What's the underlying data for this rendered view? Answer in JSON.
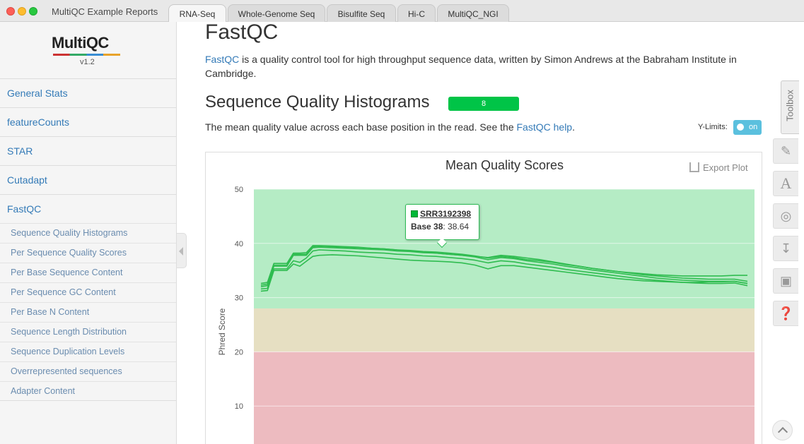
{
  "window": {
    "title": "MultiQC Example Reports",
    "tabs": [
      "RNA-Seq",
      "Whole-Genome Seq",
      "Bisulfite Seq",
      "Hi-C",
      "MultiQC_NGI"
    ],
    "active_tab": "RNA-Seq"
  },
  "sidebar": {
    "logo": "MultiQC",
    "version": "v1.2",
    "main_items": [
      "General Stats",
      "featureCounts",
      "STAR",
      "Cutadapt",
      "FastQC"
    ],
    "sub_items": [
      "Sequence Quality Histograms",
      "Per Sequence Quality Scores",
      "Per Base Sequence Content",
      "Per Sequence GC Content",
      "Per Base N Content",
      "Sequence Length Distribution",
      "Sequence Duplication Levels",
      "Overrepresented sequences",
      "Adapter Content"
    ]
  },
  "main": {
    "title": "FastQC",
    "intro_link": "FastQC",
    "intro_text": " is a quality control tool for high throughput sequence data, written by Simon Andrews at the Babraham Institute in Cambridge.",
    "section_title": "Sequence Quality Histograms",
    "badge_count": "8",
    "section_desc": "The mean quality value across each base position in the read. See the ",
    "section_link": "FastQC help",
    "section_desc_end": ".",
    "ylimits_label": "Y-Limits:",
    "ylimits_state": "on"
  },
  "plot": {
    "export_label": "Export Plot",
    "tooltip": {
      "sample": "SRR3192398",
      "base_label": "Base 38",
      "value": ": 38.64"
    }
  },
  "toolbox": {
    "label": "Toolbox",
    "tools": [
      "pin-icon",
      "font-icon",
      "eye-slash-icon",
      "download-icon",
      "save-icon",
      "question-icon"
    ]
  },
  "colors": {
    "good_zone": "#b5ecc5",
    "warn_zone": "#e6dfc2",
    "fail_zone": "#edbbc0",
    "line": "#2fbc50",
    "link": "#337ab7",
    "badge": "#00c447"
  },
  "chart_data": {
    "type": "line",
    "title": "Mean Quality Scores",
    "xlabel": "",
    "ylabel": "Phred Score",
    "ylim": [
      0,
      50
    ],
    "yticks": [
      10,
      20,
      30,
      40,
      50
    ],
    "zones": [
      {
        "from": 0,
        "to": 20,
        "color": "#edbbc0"
      },
      {
        "from": 20,
        "to": 28,
        "color": "#e6dfc2"
      },
      {
        "from": 28,
        "to": 50,
        "color": "#b5ecc5"
      }
    ],
    "x": [
      1,
      2,
      3,
      4,
      5,
      6,
      7,
      8,
      9,
      10,
      12,
      14,
      16,
      18,
      20,
      22,
      24,
      26,
      28,
      30,
      32,
      34,
      36,
      38,
      40,
      42,
      44,
      46,
      48,
      50,
      52,
      54,
      56,
      58,
      60,
      62,
      64,
      66,
      68,
      70,
      72,
      74,
      76
    ],
    "series": [
      {
        "values": [
          32.0,
          32.2,
          35.8,
          35.8,
          35.8,
          37.8,
          37.8,
          37.8,
          39.2,
          39.3,
          39.2,
          39.1,
          39.0,
          38.9,
          38.8,
          38.6,
          38.5,
          38.3,
          38.2,
          38.0,
          37.8,
          37.5,
          37.0,
          37.4,
          37.2,
          36.8,
          36.5,
          36.2,
          35.8,
          35.5,
          35.1,
          34.8,
          34.5,
          34.2,
          33.9,
          33.6,
          33.4,
          33.2,
          33.1,
          33.0,
          33.0,
          33.0,
          32.6
        ]
      },
      {
        "values": [
          32.3,
          32.5,
          36.0,
          36.0,
          36.0,
          38.0,
          38.0,
          38.0,
          39.4,
          39.5,
          39.4,
          39.3,
          39.2,
          39.1,
          39.0,
          38.8,
          38.7,
          38.5,
          38.4,
          38.2,
          38.0,
          37.7,
          37.3,
          37.6,
          37.4,
          37.0,
          36.8,
          36.5,
          36.1,
          35.8,
          35.4,
          35.1,
          34.8,
          34.5,
          34.2,
          34.0,
          33.8,
          33.6,
          33.5,
          33.4,
          33.4,
          33.4,
          33.0
        ]
      },
      {
        "values": [
          31.6,
          31.7,
          35.3,
          35.3,
          35.3,
          36.8,
          36.5,
          37.3,
          38.6,
          38.8,
          38.7,
          38.6,
          38.4,
          38.3,
          38.2,
          38.0,
          37.9,
          37.7,
          37.6,
          37.4,
          37.2,
          36.9,
          36.4,
          36.8,
          36.6,
          36.2,
          35.9,
          35.6,
          35.2,
          34.9,
          34.6,
          34.3,
          34.0,
          33.7,
          33.4,
          33.2,
          33.0,
          32.8,
          32.7,
          32.6,
          32.6,
          32.7,
          32.2
        ]
      },
      {
        "values": [
          31.2,
          31.3,
          35.0,
          35.0,
          35.0,
          36.2,
          35.8,
          36.7,
          37.6,
          37.8,
          37.9,
          37.8,
          37.7,
          37.5,
          37.3,
          37.1,
          36.9,
          36.8,
          36.7,
          36.6,
          36.4,
          36.0,
          35.3,
          35.9,
          35.9,
          35.6,
          35.3,
          35.0,
          34.7,
          34.4,
          34.1,
          33.8,
          33.5,
          33.3,
          33.1,
          33.0,
          32.9,
          32.8,
          32.8,
          32.9,
          32.9,
          33.0,
          32.6
        ]
      },
      {
        "values": [
          32.6,
          32.8,
          36.3,
          36.3,
          36.3,
          38.2,
          38.2,
          38.3,
          39.6,
          39.6,
          39.5,
          39.4,
          39.3,
          39.1,
          39.0,
          38.8,
          38.6,
          38.4,
          38.2,
          38.0,
          37.8,
          37.6,
          37.4,
          37.8,
          37.6,
          37.3,
          37.0,
          36.6,
          36.2,
          35.8,
          35.4,
          35.1,
          34.8,
          34.6,
          34.4,
          34.2,
          34.1,
          34.0,
          34.0,
          34.0,
          34.0,
          34.1,
          34.1
        ]
      }
    ],
    "highlight": {
      "x": 38,
      "value": 38.64,
      "series_name": "SRR3192398"
    }
  }
}
